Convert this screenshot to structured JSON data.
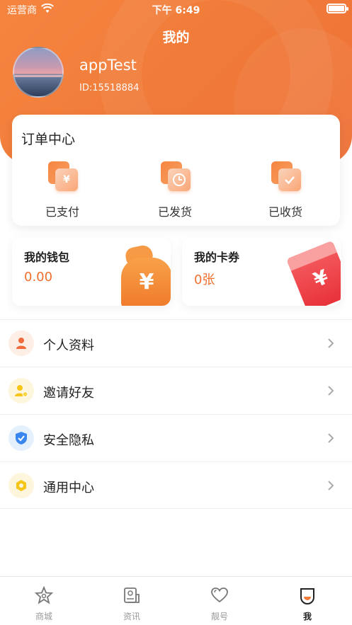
{
  "status_bar": {
    "carrier": "运营商",
    "time": "下午 6:49"
  },
  "header": {
    "title": "我的"
  },
  "profile": {
    "name": "appTest",
    "id": "ID:15518884"
  },
  "order_center": {
    "title": "订单中心",
    "items": [
      {
        "label": "已支付",
        "icon": "yen-icon"
      },
      {
        "label": "已发货",
        "icon": "clock-icon"
      },
      {
        "label": "已收货",
        "icon": "check-icon"
      }
    ]
  },
  "wallet": {
    "title": "我的钱包",
    "value": "0.00"
  },
  "coupons": {
    "title": "我的卡券",
    "value": "0张"
  },
  "menu": [
    {
      "label": "个人资料",
      "icon": "person-icon",
      "color": "#f26a3b"
    },
    {
      "label": "邀请好友",
      "icon": "add-user-icon",
      "color": "#f5c518"
    },
    {
      "label": "安全隐私",
      "icon": "shield-icon",
      "color": "#3a86f0"
    },
    {
      "label": "通用中心",
      "icon": "hexagon-icon",
      "color": "#f5c518"
    }
  ],
  "tabbar": [
    {
      "label": "商城",
      "icon": "star-icon"
    },
    {
      "label": "资讯",
      "icon": "news-icon"
    },
    {
      "label": "靓号",
      "icon": "heart-icon"
    },
    {
      "label": "我",
      "icon": "face-icon",
      "active": true
    }
  ],
  "colors": {
    "accent": "#f07a39",
    "value_text": "#ef6f2e",
    "coupon_red": "#e8323a"
  }
}
